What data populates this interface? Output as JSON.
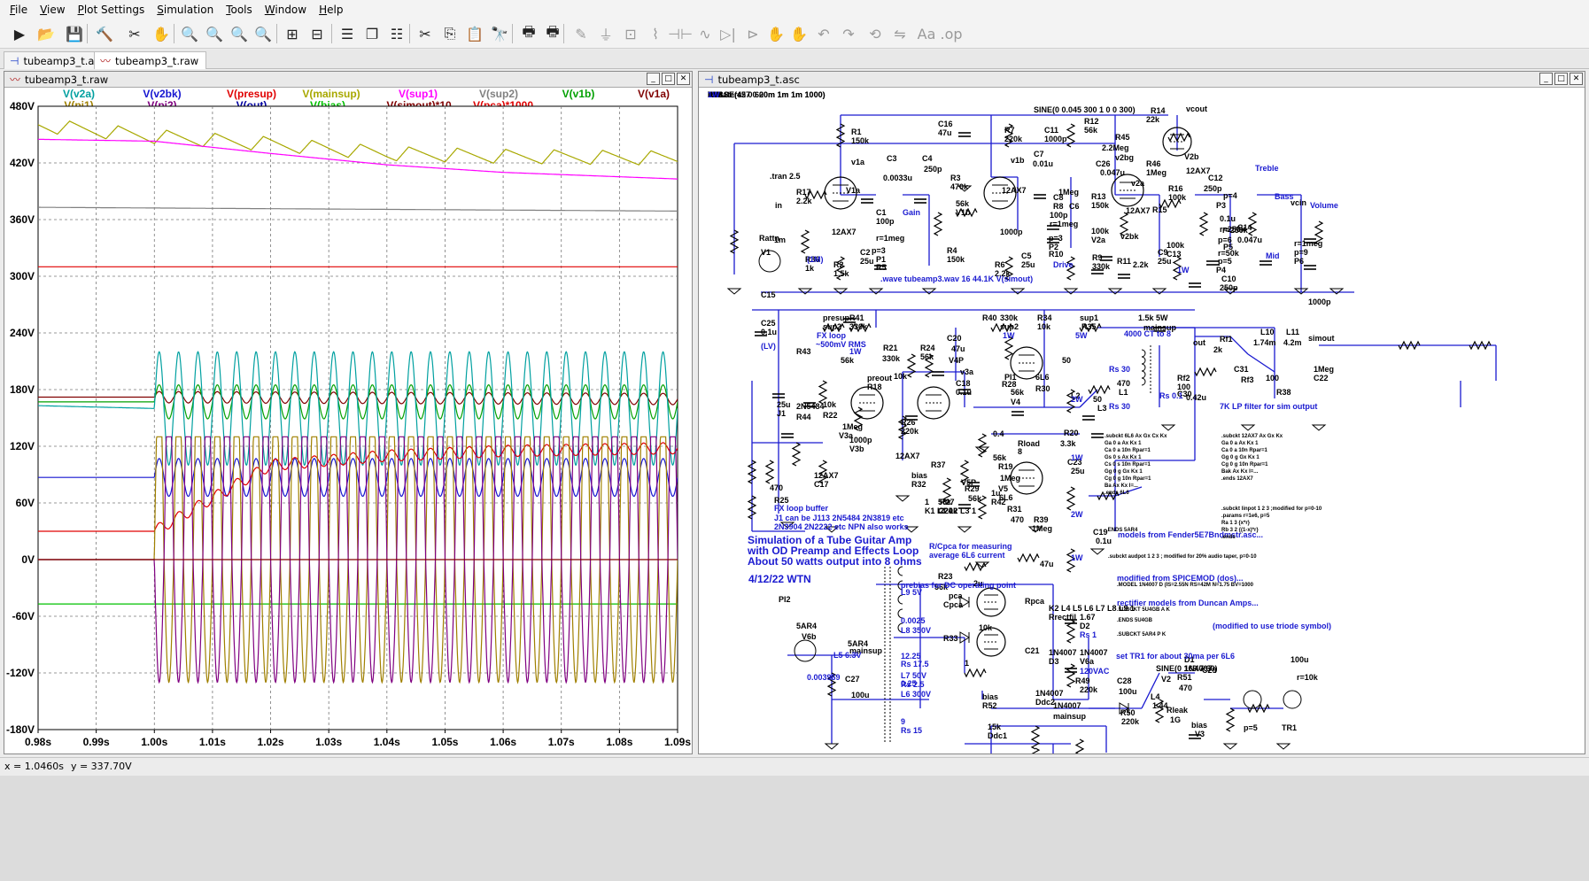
{
  "menubar": {
    "items": [
      "File",
      "View",
      "Plot Settings",
      "Simulation",
      "Tools",
      "Window",
      "Help"
    ]
  },
  "toolbar": {
    "icons": [
      {
        "name": "run-icon",
        "glyph": "▶"
      },
      {
        "name": "open-icon",
        "glyph": "📂"
      },
      {
        "name": "save-icon",
        "glyph": "💾"
      },
      {
        "name": "control-panel-icon",
        "glyph": "🔨"
      },
      {
        "name": "halt-icon",
        "glyph": "✂"
      },
      {
        "name": "pan-icon",
        "glyph": "✋"
      },
      {
        "name": "zoom-area-icon",
        "glyph": "🔍"
      },
      {
        "name": "zoom-back-icon",
        "glyph": "🔍"
      },
      {
        "name": "zoom-out-icon",
        "glyph": "🔍"
      },
      {
        "name": "zoom-fit-icon",
        "glyph": "🔍"
      },
      {
        "name": "autorange-icon",
        "glyph": "⊞"
      },
      {
        "name": "cursor-icon",
        "glyph": "⊟"
      },
      {
        "name": "tile-horizontal-icon",
        "glyph": "☰"
      },
      {
        "name": "cascade-icon",
        "glyph": "❐"
      },
      {
        "name": "tile-vertical-icon",
        "glyph": "☷"
      },
      {
        "name": "cut-icon",
        "glyph": "✂"
      },
      {
        "name": "copy-icon",
        "glyph": "⎘"
      },
      {
        "name": "paste-icon",
        "glyph": "📋"
      },
      {
        "name": "find-icon",
        "glyph": "🔭"
      },
      {
        "name": "print-icon",
        "glyph": "🖶"
      },
      {
        "name": "print-setup-icon",
        "glyph": "🖶"
      },
      {
        "name": "draw-wire-icon",
        "glyph": "✎"
      },
      {
        "name": "ground-icon",
        "glyph": "⏚"
      },
      {
        "name": "label-net-icon",
        "glyph": "⊡"
      },
      {
        "name": "resistor-icon",
        "glyph": "⌇"
      },
      {
        "name": "capacitor-icon",
        "glyph": "⊣⊢"
      },
      {
        "name": "inductor-icon",
        "glyph": "∿"
      },
      {
        "name": "diode-icon",
        "glyph": "▷|"
      },
      {
        "name": "component-icon",
        "glyph": "⊳"
      },
      {
        "name": "move-icon",
        "glyph": "✋"
      },
      {
        "name": "drag-icon",
        "glyph": "✋"
      },
      {
        "name": "undo-icon",
        "glyph": "↶"
      },
      {
        "name": "redo-icon",
        "glyph": "↷"
      },
      {
        "name": "rotate-icon",
        "glyph": "⟲"
      },
      {
        "name": "mirror-icon",
        "glyph": "⇋"
      },
      {
        "name": "text-icon",
        "glyph": "Aa"
      },
      {
        "name": "spice-directive-icon",
        "glyph": ".op"
      }
    ]
  },
  "tabs": [
    {
      "label": "tubeamp3_t.asc",
      "type": "schematic"
    },
    {
      "label": "tubeamp3_t.raw",
      "type": "plot"
    }
  ],
  "plot_window": {
    "title": "tubeamp3_t.raw"
  },
  "schematic_window": {
    "title": "tubeamp3_t.asc"
  },
  "status": {
    "x": "x = 1.0460s",
    "y": "y = 337.70V"
  },
  "chart_data": {
    "type": "line",
    "xlim": [
      0.98,
      1.09
    ],
    "ylim": [
      -180,
      480
    ],
    "xticks": [
      0.98,
      0.99,
      1.0,
      1.01,
      1.02,
      1.03,
      1.04,
      1.05,
      1.06,
      1.07,
      1.08,
      1.09
    ],
    "xtick_labels": [
      "0.98s",
      "0.99s",
      "1.00s",
      "1.01s",
      "1.02s",
      "1.03s",
      "1.04s",
      "1.05s",
      "1.06s",
      "1.07s",
      "1.08s",
      "1.09s"
    ],
    "yticks": [
      480,
      420,
      360,
      300,
      240,
      180,
      120,
      60,
      0,
      -60,
      -120,
      -180
    ],
    "ytick_labels": [
      "480V",
      "420V",
      "360V",
      "300V",
      "240V",
      "180V",
      "120V",
      "60V",
      "0V",
      "-60V",
      "-120V",
      "-180V"
    ],
    "grid": true,
    "legend": [
      {
        "label": "V(v2a)",
        "color": "#00a0a0"
      },
      {
        "label": "V(v2bk)",
        "color": "#1515d0"
      },
      {
        "label": "V(presup)",
        "color": "#e00000"
      },
      {
        "label": "V(mainsup)",
        "color": "#a8a800"
      },
      {
        "label": "V(sup1)",
        "color": "#ff00ff"
      },
      {
        "label": "V(sup2)",
        "color": "#808080"
      },
      {
        "label": "V(v1b)",
        "color": "#00a000"
      },
      {
        "label": "V(v1a)",
        "color": "#800000"
      },
      {
        "label": "V(pi1)",
        "color": "#a08000"
      },
      {
        "label": "V(pi2)",
        "color": "#800080"
      },
      {
        "label": "V(out)",
        "color": "#0000a0"
      },
      {
        "label": "V(bias)",
        "color": "#00c000"
      },
      {
        "label": "V(simout)*10",
        "color": "#800000"
      },
      {
        "label": "V(pca)*1000",
        "color": "#e00000"
      }
    ],
    "series": [
      {
        "name": "V(mainsup)",
        "color": "#a8a800",
        "x": [
          0.98,
          1.0,
          1.02,
          1.04,
          1.06,
          1.09
        ],
        "y": [
          460,
          448,
          440,
          430,
          427,
          425
        ],
        "ripple": 15,
        "freq": 120
      },
      {
        "name": "V(sup1)",
        "color": "#ff00ff",
        "x": [
          0.98,
          1.0,
          1.02,
          1.04,
          1.06,
          1.09
        ],
        "y": [
          445,
          443,
          430,
          418,
          410,
          403
        ]
      },
      {
        "name": "V(sup2)",
        "color": "#808080",
        "x": [
          0.98,
          1.09
        ],
        "y": [
          373,
          369
        ]
      },
      {
        "name": "V(presup)",
        "color": "#e00000",
        "x": [
          0.98,
          1.09
        ],
        "y": [
          310,
          310
        ]
      },
      {
        "name": "V(v1a)",
        "color": "#800000",
        "x": [
          0.98,
          1.0,
          1.09
        ],
        "y": [
          172,
          172,
          170
        ],
        "amp_after": 6,
        "freq": 300
      },
      {
        "name": "V(v1b)",
        "color": "#00a000",
        "x": [
          0.98,
          1.0,
          1.09
        ],
        "y": [
          167,
          167,
          167
        ],
        "amp_after": 18,
        "freq": 300
      },
      {
        "name": "V(v2a)",
        "color": "#00a0a0",
        "x": [
          0.98,
          1.0,
          1.09
        ],
        "y": [
          163,
          160,
          160
        ],
        "amp_after": 60,
        "freq": 300
      },
      {
        "name": "V(v2bk)",
        "color": "#1515d0",
        "x": [
          0.98,
          1.0,
          1.09
        ],
        "y": [
          87,
          87,
          87
        ],
        "amp_after": 20,
        "freq": 300
      },
      {
        "name": "V(pca)*1000",
        "color": "#e00000",
        "x": [
          0.98,
          1.0,
          1.02,
          1.04,
          1.06,
          1.09
        ],
        "y": [
          30,
          30,
          100,
          110,
          115,
          118
        ],
        "amp_after": 6,
        "freq": 300
      },
      {
        "name": "V(bias)",
        "color": "#00c000",
        "x": [
          0.98,
          1.09
        ],
        "y": [
          -47,
          -47
        ]
      },
      {
        "name": "V(pi1)",
        "color": "#a08000",
        "x": [
          0.98,
          1.0,
          1.09
        ],
        "y": [
          0,
          0,
          0
        ],
        "amp_after": 130,
        "freq": 300,
        "clip": true
      },
      {
        "name": "V(pi2)",
        "color": "#800080",
        "x": [
          0.98,
          1.0,
          1.09
        ],
        "y": [
          0,
          0,
          0
        ],
        "amp_after": 130,
        "freq": 300,
        "clip": true,
        "phase": 3.14
      },
      {
        "name": "V(simout)*10",
        "color": "#800000",
        "x": [
          0.98,
          1.09
        ],
        "y": [
          0,
          0
        ]
      }
    ]
  },
  "schematic": {
    "labels_black": [
      "R1",
      "150k",
      "v1a",
      "C3",
      "0.0033u",
      "C4",
      "250p",
      "R3",
      "470k",
      "C16",
      "47u",
      "R7",
      "220k",
      "C7",
      "0.01u",
      "v1b",
      "C11",
      "1000p",
      "R12",
      "56k",
      "R45",
      "2.2Meg",
      "v2bg",
      "R14",
      "22k",
      "R46",
      "1Meg",
      "C26",
      "0.047u",
      "v2a",
      "R13",
      "150k",
      "R16",
      "100k",
      "C12",
      "250p",
      "V2b",
      "12AX7",
      ".tran 2.5",
      "R17",
      "2.2k",
      "in",
      "V1a",
      "12AX7",
      "C1",
      "100p",
      "r=1meg",
      "p=3",
      "P1",
      "R5",
      "56k",
      "V1b",
      "12AX7",
      "1000p",
      "C8",
      "R8",
      "1Meg",
      "C6",
      "100p",
      "r=1meg",
      "p=3",
      "P2",
      "R10",
      "100k",
      "V2a",
      "12AX7",
      "v2bk",
      "R15",
      "100k",
      "C13",
      "0.1u",
      "r=250k",
      "p=4",
      "P3",
      "r=250k",
      "p=6",
      "P5",
      "C14",
      "0.047u",
      "r=50k",
      "p=5",
      "P4",
      "r=1meg",
      "p=9",
      "P6",
      "vcin",
      "Rattn",
      "1m",
      "V1",
      "R36",
      "1k",
      "R2",
      "1.5k",
      "C2",
      "25u",
      "R4",
      "150k",
      "R6",
      "2.2k",
      "C5",
      "25u",
      "R9",
      "330k",
      "R11",
      "2.2k",
      "C9",
      "25u",
      "C10",
      "250p",
      "C15",
      "1000p",
      "SINE(0 0.045 300 1 0 0 300)",
      "vcout",
      "presup",
      "sup2",
      "R41",
      "330k",
      "R40",
      "330k",
      "sup2",
      "R34",
      "10k",
      "sup1",
      "R35",
      "1.5k 5W",
      "mainsup",
      "C25",
      "0.1u",
      "R21",
      "330k",
      "R24",
      "56k",
      "C20",
      "47u",
      "V4P",
      "out",
      "Rf1",
      "2k",
      "L10",
      "1.74m",
      "L11",
      "4.2m",
      "simout",
      "R43",
      "56k",
      "preout",
      "R18",
      "10k",
      "v3a",
      "C18",
      "0.1u",
      "PI1",
      "R28",
      "56k",
      "V4",
      "6L6",
      "R30",
      "470",
      "L1",
      "50",
      "L2",
      "50",
      "L3",
      "0.4",
      "Rload",
      "8",
      "Rf2",
      "100",
      "C30",
      "0.42u",
      "C31",
      "Rf3",
      "100",
      "R38",
      "1Meg",
      "C22",
      "25u",
      "J1",
      "2N5484",
      "R44",
      "10k",
      "R22",
      "1Meg",
      "V3a",
      "12AX7",
      "C17",
      "1000p",
      "V3b",
      "12AX7",
      "R26",
      "220k",
      "bias",
      "R32",
      "1",
      "K1 L1 L2 L3 1",
      "R37",
      "56k",
      "C24",
      "1u",
      "R42",
      "56k",
      "R19",
      "1Meg",
      "R20",
      "3.3k",
      "C23",
      "25u",
      "R25",
      "470",
      "R27",
      "220k",
      "V5P",
      "R29",
      "56k",
      "V5",
      "6L6",
      "R31",
      "470",
      "R39",
      "1Meg",
      "C19",
      "0.1u",
      "PI2",
      "R23",
      "56k",
      "pca",
      "Cpca",
      "2u",
      "Rpca",
      "10k",
      "R33",
      "1",
      "C21",
      "47u",
      "K2 L4 L5 L6 L7 L8 L9 1",
      "Rrectfil",
      "1.67",
      "D2",
      "1N4007",
      "D3",
      "1N4007",
      "V6a",
      "5AR4",
      "V6b",
      "5AR4",
      "mainsup",
      "C27",
      "100u",
      "R49",
      "220k",
      "C28",
      "100u",
      "R50",
      "220k",
      "SINE(0 169.7 60)",
      "V2",
      "L4",
      "1.44",
      "Rleak",
      "1G",
      "R51",
      "470",
      "D1",
      "1N4007",
      "C29",
      "100u",
      "r=10k",
      "p=5",
      "TR1",
      "bias",
      "R52",
      "15k",
      "Ddc1",
      "1N4007",
      "Ddc2",
      "1N4007",
      "mainsup",
      "bias",
      "V3",
      "V6",
      "R47",
      "100",
      "R48",
      "100",
      "Rheaters",
      "2.33",
      "PULSE(427 0 20m 1m 1m 1000)",
      "PULSE(45 0 600m 1m 1m 1000)"
    ],
    "labels_blue": [
      "Gain",
      "Drive",
      "Treble",
      "Bass",
      "Mid",
      "Volume",
      "(1M)",
      "1W",
      ".wave tubeamp3.wav 16 44.1K V(simout)",
      "(LV)",
      "FX loop",
      "~500mV RMS",
      "1W",
      "5W",
      "4000 CT to 8",
      "Rs 30",
      "Rs 30",
      "Rs 0.1",
      "7K LP filter for sim output",
      "2W",
      "1W",
      "2W",
      "1W",
      "FX loop buffer",
      "J1 can be J113 2N5484 2N3819 etc",
      "2N3904 2N2222 etc NPN also works",
      "R/Cpca for measuring",
      "average 6L6 current",
      "Simulation of a Tube Guitar Amp",
      "with OD Preamp and Effects Loop",
      "About 50 watts output into 8 ohms",
      "4/12/22 WTN",
      "models from Fender5E7Bndmstr.asc...",
      "modified from SPICEMOD (dos)...",
      "rectifier models from Duncan Amps...",
      "(modified to use triode symbol)",
      "set TR1 for about 30ma per 6L6",
      "prebias for DC operating point",
      "L9 5V",
      "0.0025",
      "L8 350V",
      "12.25",
      "Rs 17.5",
      "L7 50V",
      "0.25",
      "Rs 2.5",
      "L6 300V",
      "9",
      "Rs 15",
      "L5 6.3V",
      "0.003969",
      "Rs 1",
      "120VAC",
      "1W",
      "1W",
      "1W"
    ],
    "spice_models": [
      ".subckt 6L6 Ax Gx Cx Kx",
      "Ga 0 a Ax Kx 1",
      "Ca 0 a 10n Rpar=1",
      "Gs 0 s Ax Kx 1",
      "Cs 0 s 10n Rpar=1",
      "Gg 0 g Gx Kx 1",
      "Cg 0 g 10n Rpar=1",
      "Ba Ax Kx I=...",
      ".ends 6L6",
      ".subckt 12AX7 Ax Gx Kx",
      "Ga 0 a Ax Kx 1",
      "Ca 0 a 10n Rpar=1",
      "Gg 0 g Gx Kx 1",
      "Cg 0 g 10n Rpar=1",
      "Bak Ax Kx I=...",
      ".ends 12AX7",
      ".subckt linpot 1 2 3 ;modified for p=0-10",
      ".params r=1e6, p=5",
      "Ra 1 3 {x*r}",
      "Rb 3 2 {(1-x)*r}",
      ".ends",
      ".subckt audpot 1 2 3 ; modified for 20% audio taper, p=0-10",
      ".MODEL 1N4007 D (IS=2.55N RS=42M N=1.75 BV=1000",
      ".SUBCKT 5U4GB A K",
      ".ENDS 5U4GB",
      ".SUBCKT 5AR4 P K",
      ".ENDS 5AR4"
    ]
  }
}
